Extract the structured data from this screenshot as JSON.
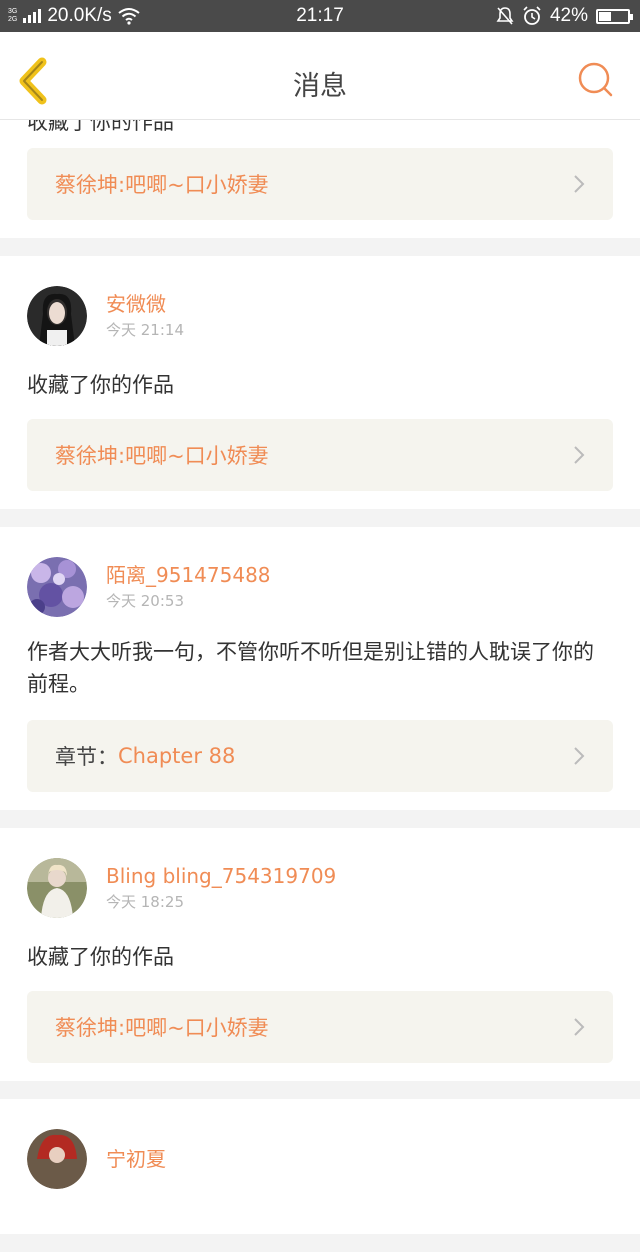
{
  "status_bar": {
    "net_top": "3G",
    "net_bottom": "2G",
    "speed": "20.0K/s",
    "time": "21:17",
    "battery_text": "42%",
    "battery_level": 0.42
  },
  "header": {
    "title": "消息",
    "back_icon": "chevron-left-icon",
    "search_icon": "search-icon"
  },
  "colors": {
    "accent": "#f08c55",
    "work_bg": "#f5f4ee",
    "page_bg": "#f3f3f3"
  },
  "messages": [
    {
      "username": "",
      "time": "",
      "message": "收藏了你的作品",
      "work_prefix": "",
      "work_title": "蔡徐坤:吧唧~口小娇妻",
      "avatar": "none"
    },
    {
      "username": "安微微",
      "time": "今天 21:14",
      "message": "收藏了你的作品",
      "work_prefix": "",
      "work_title": "蔡徐坤:吧唧~口小娇妻",
      "avatar": "portrait-dark"
    },
    {
      "username": "陌离_951475488",
      "time": "今天 20:53",
      "message": "作者大大听我一句，不管你听不听但是别让错的人耽误了你的前程。",
      "work_prefix": "章节：",
      "work_title": "Chapter 88",
      "avatar": "purple-flowers"
    },
    {
      "username": "Bling bling_754319709",
      "time": "今天 18:25",
      "message": "收藏了你的作品",
      "work_prefix": "",
      "work_title": "蔡徐坤:吧唧~口小娇妻",
      "avatar": "portrait-light"
    },
    {
      "username": "宁初夏",
      "time": "",
      "message": "",
      "work_prefix": "",
      "work_title": "",
      "avatar": "portrait-red"
    }
  ]
}
